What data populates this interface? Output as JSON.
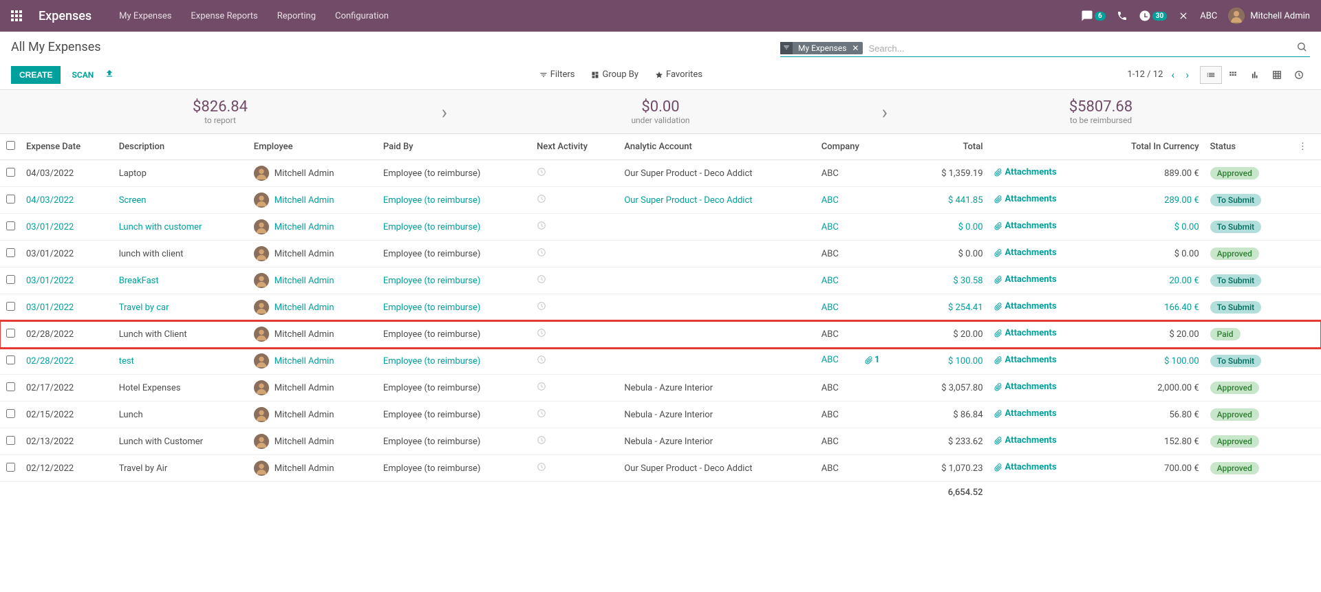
{
  "navbar": {
    "app_title": "Expenses",
    "menu": [
      "My Expenses",
      "Expense Reports",
      "Reporting",
      "Configuration"
    ],
    "chat_badge": "6",
    "clock_badge": "30",
    "company": "ABC",
    "user": "Mitchell Admin"
  },
  "breadcrumb": "All My Expenses",
  "buttons": {
    "create": "CREATE",
    "scan": "SCAN"
  },
  "search": {
    "tag": "My Expenses",
    "placeholder": "Search..."
  },
  "filters": {
    "filters": "Filters",
    "group_by": "Group By",
    "favorites": "Favorites"
  },
  "pager": "1-12 / 12",
  "dashboard": [
    {
      "amount": "$826.84",
      "label": "to report"
    },
    {
      "amount": "$0.00",
      "label": "under validation"
    },
    {
      "amount": "$5807.68",
      "label": "to be reimbursed"
    }
  ],
  "columns": {
    "date": "Expense Date",
    "desc": "Description",
    "emp": "Employee",
    "paid": "Paid By",
    "next": "Next Activity",
    "analytic": "Analytic Account",
    "company": "Company",
    "total": "Total",
    "tic": "Total In Currency",
    "status": "Status",
    "attach": "Attachments"
  },
  "rows": [
    {
      "date": "04/03/2022",
      "desc": "Laptop",
      "emp": "Mitchell Admin",
      "paid": "Employee (to reimburse)",
      "analytic": "Our Super Product - Deco Addict",
      "company": "ABC",
      "total": "$ 1,359.19",
      "tic": "889.00 €",
      "status": "Approved",
      "status_class": "approved",
      "linked": false,
      "attach_count": ""
    },
    {
      "date": "04/03/2022",
      "desc": "Screen",
      "emp": "Mitchell Admin",
      "paid": "Employee (to reimburse)",
      "analytic": "Our Super Product - Deco Addict",
      "company": "ABC",
      "total": "$ 441.85",
      "tic": "289.00 €",
      "status": "To Submit",
      "status_class": "submit",
      "linked": true,
      "attach_count": ""
    },
    {
      "date": "03/01/2022",
      "desc": "Lunch with customer",
      "emp": "Mitchell Admin",
      "paid": "Employee (to reimburse)",
      "analytic": "",
      "company": "ABC",
      "total": "$ 0.00",
      "tic": "$ 0.00",
      "status": "To Submit",
      "status_class": "submit",
      "linked": true,
      "attach_count": ""
    },
    {
      "date": "03/01/2022",
      "desc": "lunch with client",
      "emp": "Mitchell Admin",
      "paid": "Employee (to reimburse)",
      "analytic": "",
      "company": "ABC",
      "total": "$ 0.00",
      "tic": "$ 0.00",
      "status": "Approved",
      "status_class": "approved",
      "linked": false,
      "attach_count": ""
    },
    {
      "date": "03/01/2022",
      "desc": "BreakFast",
      "emp": "Mitchell Admin",
      "paid": "Employee (to reimburse)",
      "analytic": "",
      "company": "ABC",
      "total": "$ 30.58",
      "tic": "20.00 €",
      "status": "To Submit",
      "status_class": "submit",
      "linked": true,
      "attach_count": ""
    },
    {
      "date": "03/01/2022",
      "desc": "Travel by car",
      "emp": "Mitchell Admin",
      "paid": "Employee (to reimburse)",
      "analytic": "",
      "company": "ABC",
      "total": "$ 254.41",
      "tic": "166.40 €",
      "status": "To Submit",
      "status_class": "submit",
      "linked": true,
      "attach_count": ""
    },
    {
      "date": "02/28/2022",
      "desc": "Lunch with Client",
      "emp": "Mitchell Admin",
      "paid": "Employee (to reimburse)",
      "analytic": "",
      "company": "ABC",
      "total": "$ 20.00",
      "tic": "$ 20.00",
      "status": "Paid",
      "status_class": "paid",
      "linked": false,
      "highlighted": true,
      "attach_count": ""
    },
    {
      "date": "02/28/2022",
      "desc": "test",
      "emp": "Mitchell Admin",
      "paid": "Employee (to reimburse)",
      "analytic": "",
      "company": "ABC",
      "total": "$ 100.00",
      "tic": "$ 100.00",
      "status": "To Submit",
      "status_class": "submit",
      "linked": true,
      "attach_count": "1"
    },
    {
      "date": "02/17/2022",
      "desc": "Hotel Expenses",
      "emp": "Mitchell Admin",
      "paid": "Employee (to reimburse)",
      "analytic": "Nebula - Azure Interior",
      "company": "ABC",
      "total": "$ 3,057.80",
      "tic": "2,000.00 €",
      "status": "Approved",
      "status_class": "approved",
      "linked": false,
      "attach_count": ""
    },
    {
      "date": "02/15/2022",
      "desc": "Lunch",
      "emp": "Mitchell Admin",
      "paid": "Employee (to reimburse)",
      "analytic": "Nebula - Azure Interior",
      "company": "ABC",
      "total": "$ 86.84",
      "tic": "56.80 €",
      "status": "Approved",
      "status_class": "approved",
      "linked": false,
      "attach_count": ""
    },
    {
      "date": "02/13/2022",
      "desc": "Lunch with Customer",
      "emp": "Mitchell Admin",
      "paid": "Employee (to reimburse)",
      "analytic": "Nebula - Azure Interior",
      "company": "ABC",
      "total": "$ 233.62",
      "tic": "152.80 €",
      "status": "Approved",
      "status_class": "approved",
      "linked": false,
      "attach_count": ""
    },
    {
      "date": "02/12/2022",
      "desc": "Travel by Air",
      "emp": "Mitchell Admin",
      "paid": "Employee (to reimburse)",
      "analytic": "Our Super Product - Deco Addict",
      "company": "ABC",
      "total": "$ 1,070.23",
      "tic": "700.00 €",
      "status": "Approved",
      "status_class": "approved",
      "linked": false,
      "attach_count": ""
    }
  ],
  "footer_total": "6,654.52"
}
